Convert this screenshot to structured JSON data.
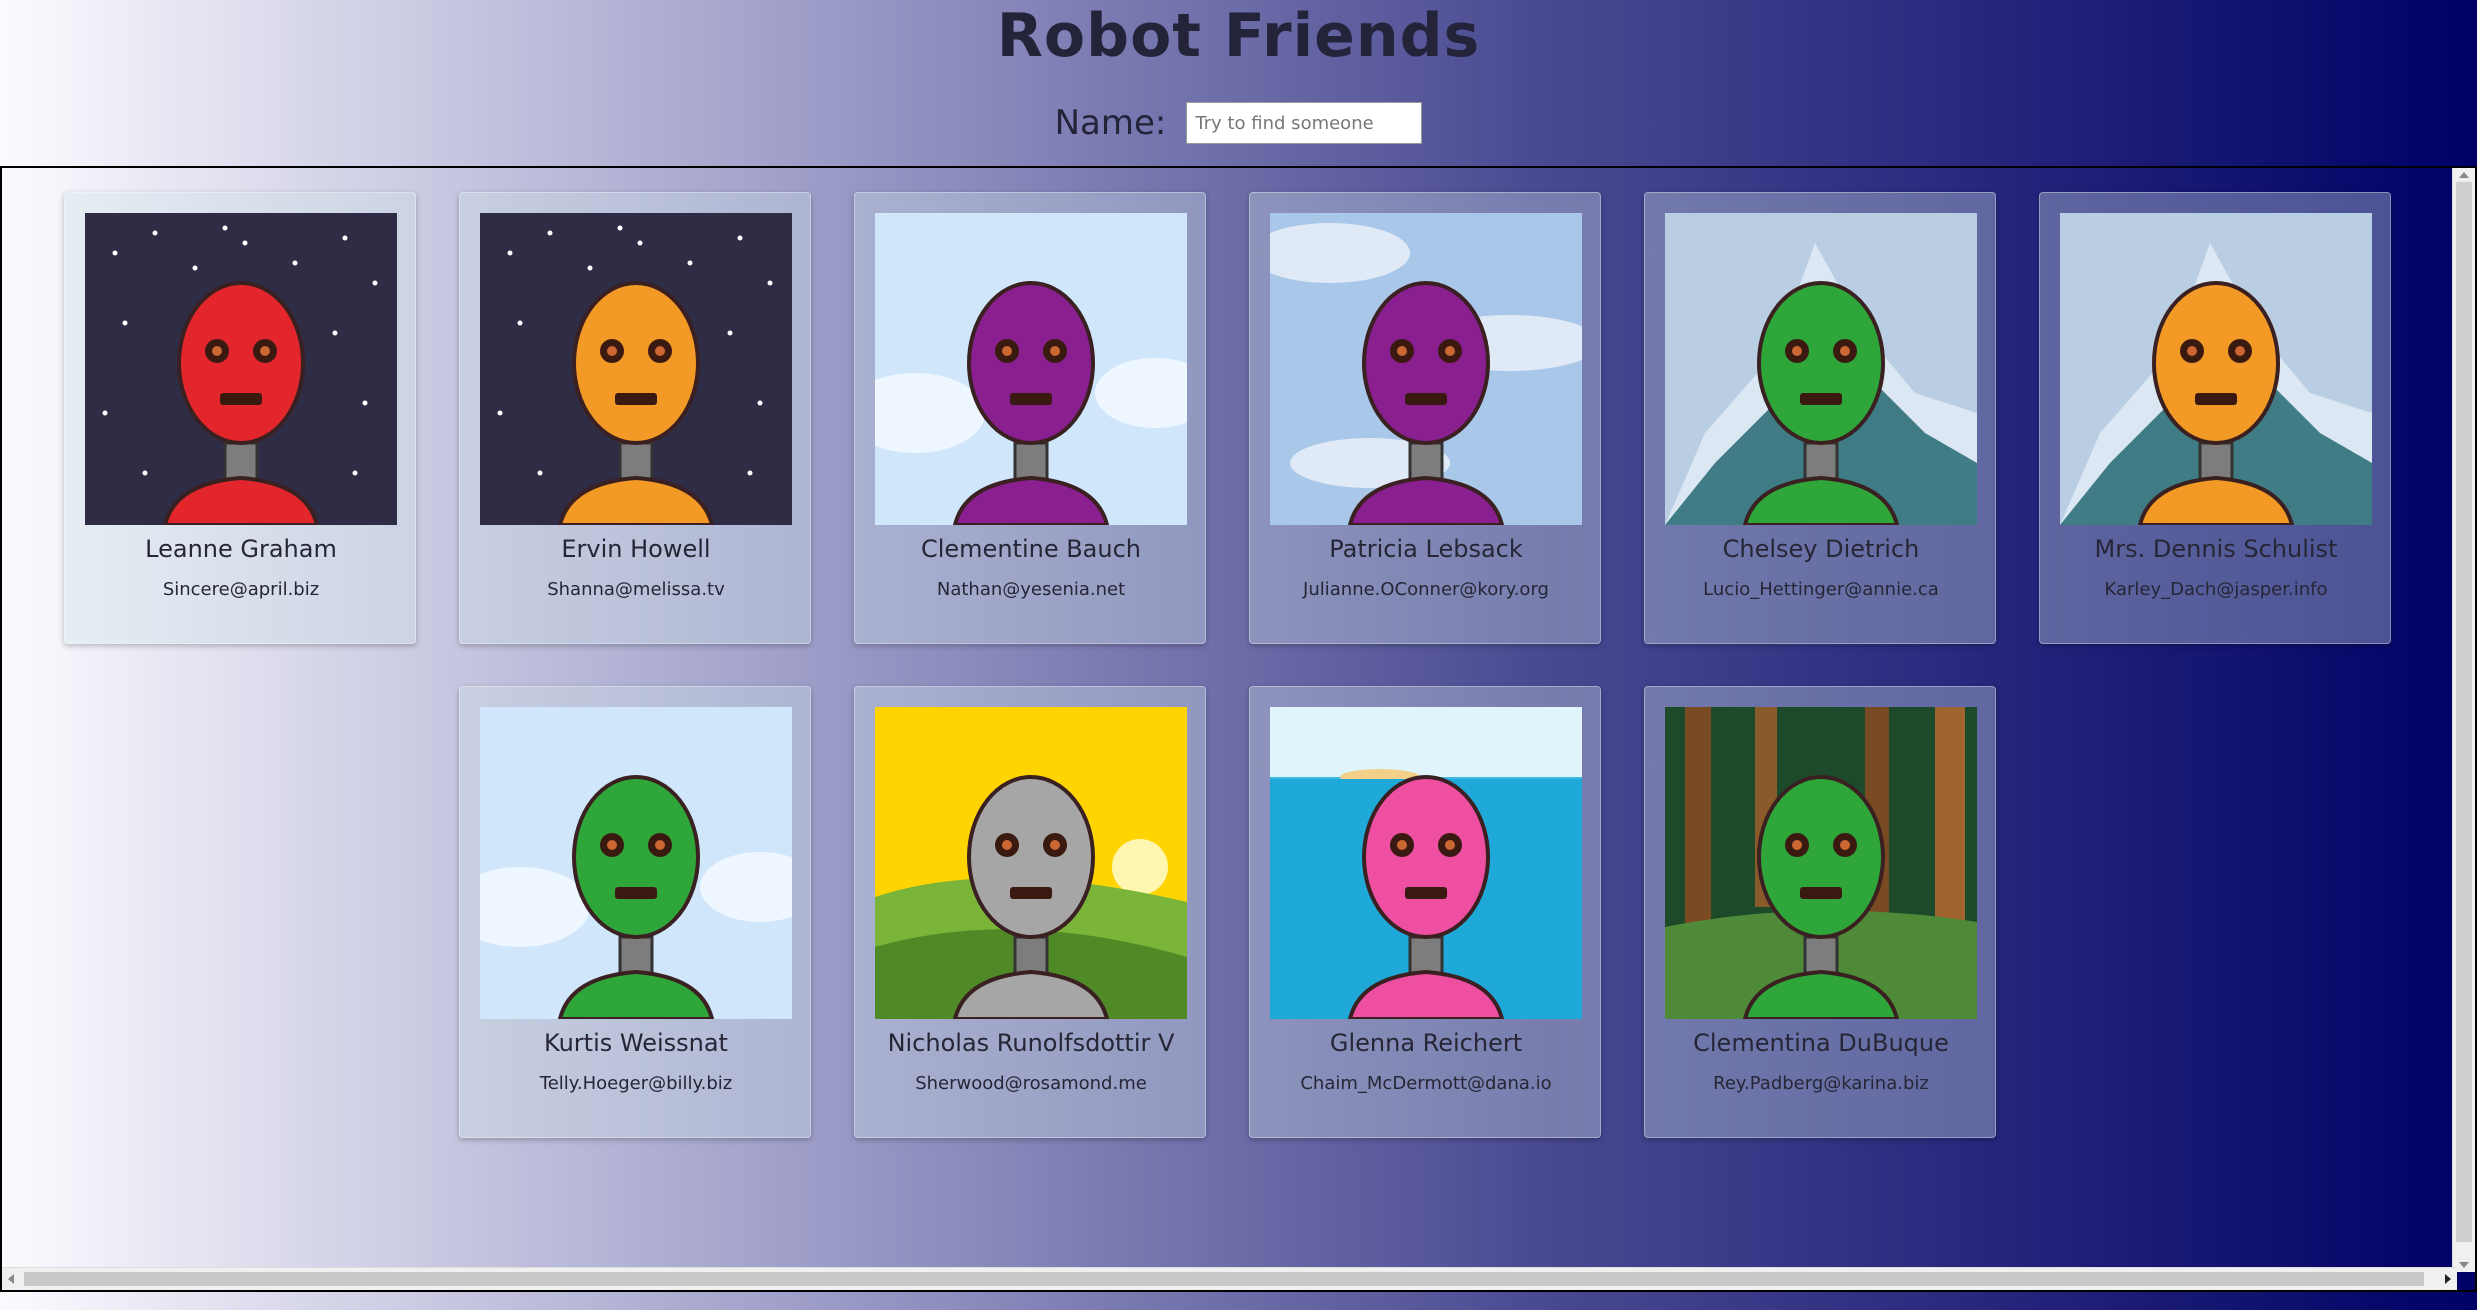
{
  "header": {
    "title": "Robot Friends"
  },
  "search": {
    "label": "Name:",
    "placeholder": "Try to find someone",
    "value": ""
  },
  "robots": [
    {
      "name": "Leanne Graham",
      "email": "Sincere@april.biz",
      "bg": "space",
      "color": "#e3262c"
    },
    {
      "name": "Ervin Howell",
      "email": "Shanna@melissa.tv",
      "bg": "space",
      "color": "#f39a26"
    },
    {
      "name": "Clementine Bauch",
      "email": "Nathan@yesenia.net",
      "bg": "sky",
      "color": "#8a1f8f"
    },
    {
      "name": "Patricia Lebsack",
      "email": "Julianne.OConner@kory.org",
      "bg": "clouds",
      "color": "#8a1f8f"
    },
    {
      "name": "Chelsey Dietrich",
      "email": "Lucio_Hettinger@annie.ca",
      "bg": "mountain",
      "color": "#2fa63a"
    },
    {
      "name": "Mrs. Dennis Schulist",
      "email": "Karley_Dach@jasper.info",
      "bg": "mountain",
      "color": "#f39a26"
    },
    {
      "name": "Kurtis Weissnat",
      "email": "Telly.Hoeger@billy.biz",
      "bg": "sky",
      "color": "#2fa63a"
    },
    {
      "name": "Nicholas Runolfsdottir V",
      "email": "Sherwood@rosamond.me",
      "bg": "sunset",
      "color": "#a6a6a6"
    },
    {
      "name": "Glenna Reichert",
      "email": "Chaim_McDermott@dana.io",
      "bg": "ocean",
      "color": "#ee4fa0"
    },
    {
      "name": "Clementina DuBuque",
      "email": "Rey.Padberg@karina.biz",
      "bg": "forest",
      "color": "#2fa63a"
    }
  ]
}
